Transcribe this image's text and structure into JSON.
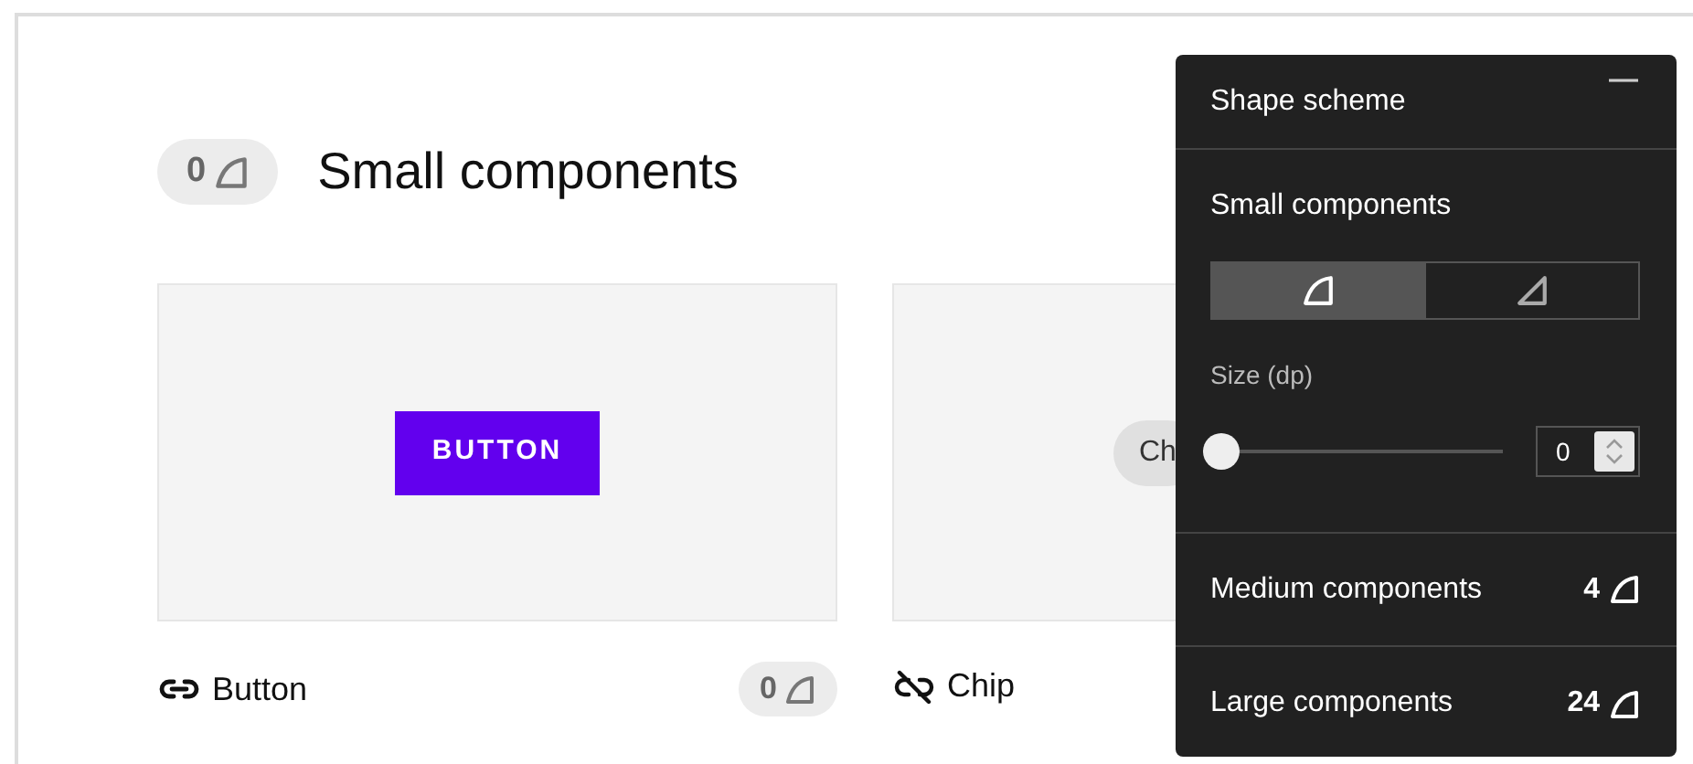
{
  "header": {
    "badge": {
      "value": "0",
      "kind": "rounded"
    },
    "title": "Small components"
  },
  "cards": [
    {
      "preview": {
        "kind": "button",
        "label": "BUTTON"
      },
      "name": "Button",
      "linked": true,
      "badge": {
        "value": "0",
        "kind": "rounded"
      }
    },
    {
      "preview": {
        "kind": "chip",
        "label": "Ch"
      },
      "name": "Chip",
      "linked": false
    }
  ],
  "panel": {
    "title": "Shape scheme",
    "expanded": true,
    "sections": [
      {
        "kind": "editor",
        "title": "Small components",
        "shape_options": [
          {
            "kind": "rounded",
            "selected": true
          },
          {
            "kind": "cut",
            "selected": false
          }
        ],
        "size_label": "Size (dp)",
        "level": 0,
        "value": "0"
      },
      {
        "kind": "summary",
        "title": "Medium components",
        "badge": {
          "value": "4",
          "kind": "rounded"
        }
      },
      {
        "kind": "summary",
        "title": "Large components",
        "badge": {
          "value": "24",
          "kind": "rounded"
        }
      }
    ]
  }
}
